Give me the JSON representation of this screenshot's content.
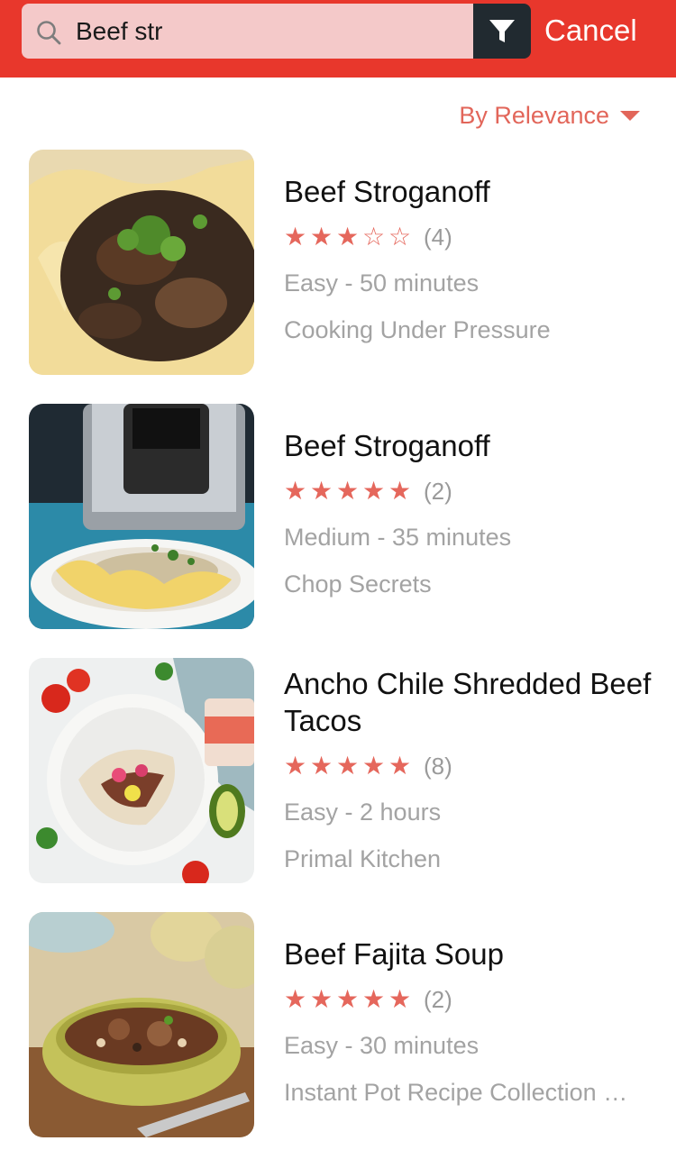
{
  "search": {
    "query": "Beef str",
    "cancel_label": "Cancel"
  },
  "sort": {
    "label": "By Relevance"
  },
  "icons": {
    "search": "search-icon",
    "filter": "filter-icon",
    "caret": "caret-down-icon",
    "star": "star-icon"
  },
  "colors": {
    "accent": "#e8372c",
    "star": "#e5675c",
    "sort": "#e2665a",
    "filter_bg": "#212a30"
  },
  "recipes": [
    {
      "title": "Beef Stroganoff",
      "rating": 3,
      "rating_max": 5,
      "count": "(4)",
      "meta": "Easy - 50 minutes",
      "source": "Cooking Under Pressure"
    },
    {
      "title": "Beef Stroganoff",
      "rating": 5,
      "rating_max": 5,
      "count": "(2)",
      "meta": "Medium - 35 minutes",
      "source": "Chop Secrets"
    },
    {
      "title": "Ancho Chile Shredded Beef Tacos",
      "rating": 5,
      "rating_max": 5,
      "count": "(8)",
      "meta": "Easy - 2 hours",
      "source": "Primal Kitchen"
    },
    {
      "title": "Beef Fajita Soup",
      "rating": 5,
      "rating_max": 5,
      "count": "(2)",
      "meta": "Easy - 30 minutes",
      "source": "Instant Pot Recipe Collection …"
    }
  ]
}
